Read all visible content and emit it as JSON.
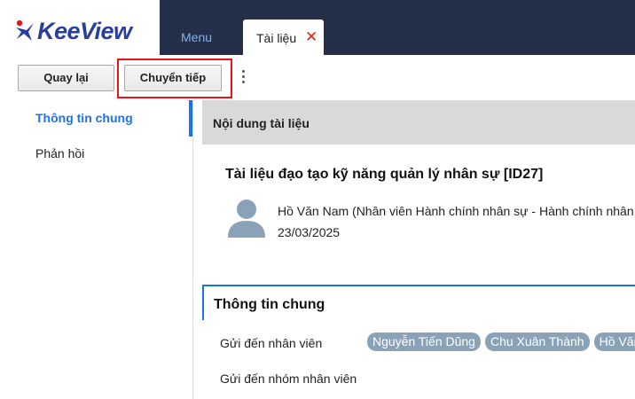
{
  "app": {
    "logo_text": "KeeView"
  },
  "top_nav": {
    "menu_label": "Menu",
    "active_tab_label": "Tài liệu",
    "close_glyph": "✕"
  },
  "toolbar": {
    "back_label": "Quay lại",
    "forward_label": "Chuyển tiếp"
  },
  "sidebar": {
    "items": [
      {
        "label": "Thông tin chung"
      },
      {
        "label": "Phản hồi"
      }
    ]
  },
  "content": {
    "header_title": "Nội dung tài liệu",
    "document_title": "Tài liệu đạo tạo kỹ năng quản lý nhân sự [ID27]",
    "author": "Hồ Văn Nam (Nhân viên Hành chính nhân sự - Hành chính nhân sự)",
    "date": "23/03/2025"
  },
  "general_info": {
    "title": "Thông tin chung",
    "send_to_employees_label": "Gửi đến nhân viên",
    "send_to_groups_label": "Gửi đến nhóm nhân viên",
    "recipients": [
      "Nguyễn Tiến Dũng",
      "Chu Xuân Thành",
      "Hồ Văn Nam"
    ]
  },
  "colors": {
    "topbar": "#243049",
    "accent": "#1a73e8",
    "highlight_border": "#e8141a",
    "chip": "#8aa2b8",
    "close_icon": "#e0201c"
  }
}
